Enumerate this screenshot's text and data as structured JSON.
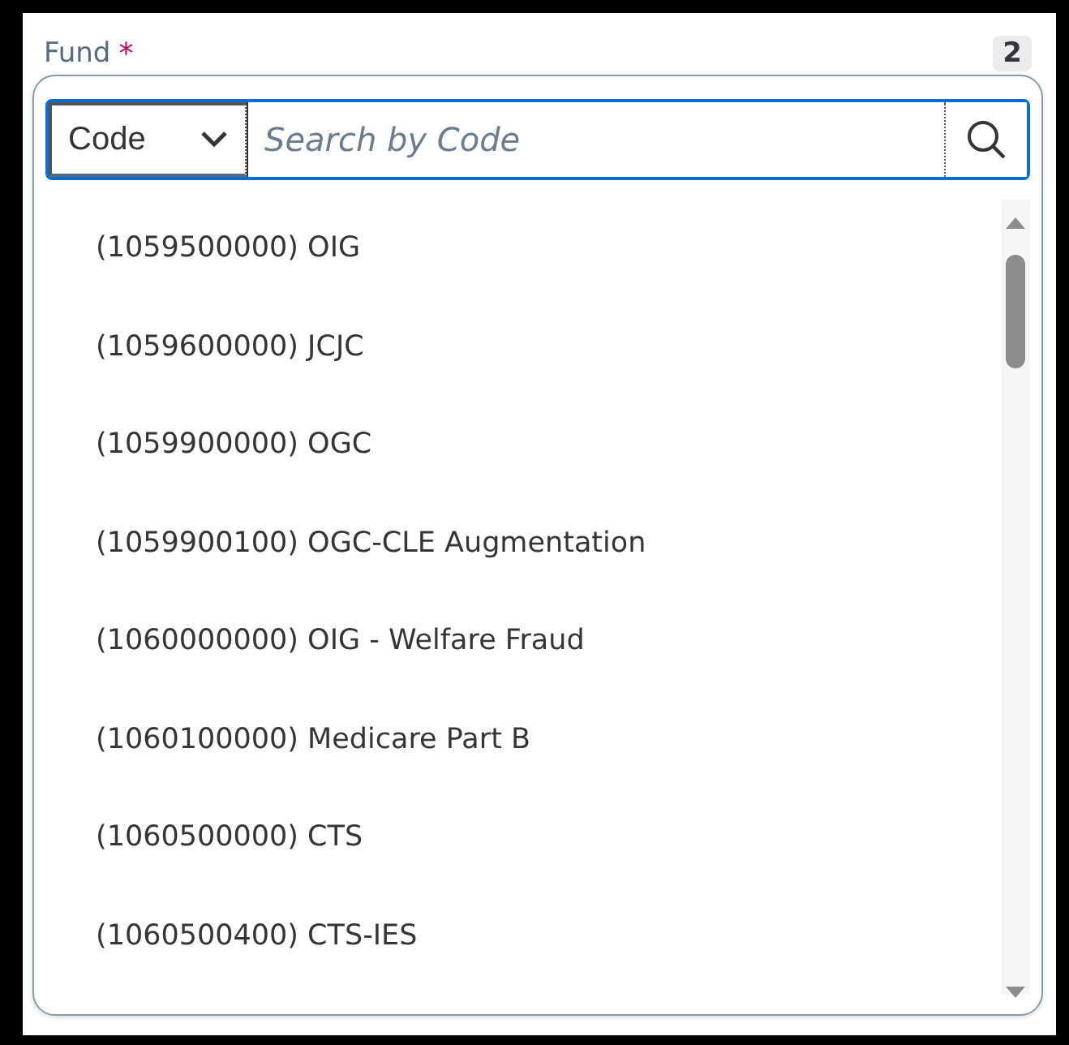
{
  "field": {
    "label": "Fund",
    "required_mark": "*",
    "count": "2"
  },
  "search": {
    "filter": "Code",
    "placeholder": "Search by Code"
  },
  "items": [
    {
      "label": "(1059500000) OIG"
    },
    {
      "label": "(1059600000) JCJC"
    },
    {
      "label": "(1059900000) OGC"
    },
    {
      "label": "(1059900100) OGC-CLE Augmentation"
    },
    {
      "label": "(1060000000) OIG - Welfare Fraud"
    },
    {
      "label": "(1060100000) Medicare Part B"
    },
    {
      "label": "(1060500000) CTS"
    },
    {
      "label": "(1060500400) CTS-IES"
    }
  ]
}
